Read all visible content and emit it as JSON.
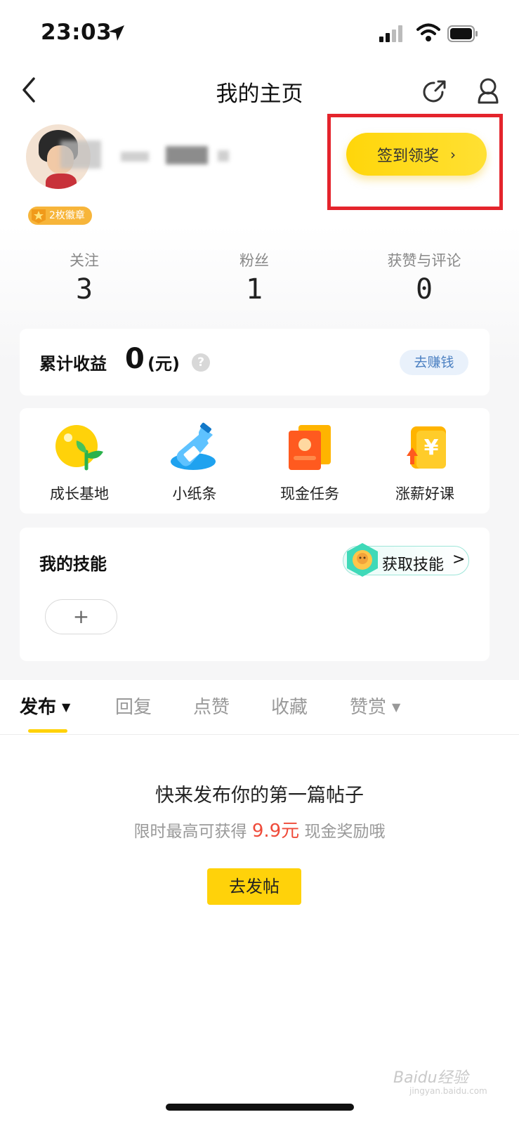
{
  "status_bar": {
    "time": "23:03"
  },
  "nav": {
    "title": "我的主页"
  },
  "profile": {
    "badge_label": "2枚徽章",
    "signin_label": "签到领奖",
    "signin_chevron": "›"
  },
  "stats": [
    {
      "label": "关注",
      "value": "3"
    },
    {
      "label": "粉丝",
      "value": "1"
    },
    {
      "label": "获赞与评论",
      "value": "0"
    }
  ],
  "earnings": {
    "title": "累计收益",
    "value": "0",
    "unit": "(元)",
    "help_symbol": "?",
    "button_label": "去赚钱"
  },
  "shortcuts": [
    {
      "label": "成长基地",
      "icon": "sprout-icon"
    },
    {
      "label": "小纸条",
      "icon": "bottle-icon"
    },
    {
      "label": "现金任务",
      "icon": "cash-card-icon"
    },
    {
      "label": "涨薪好课",
      "icon": "yen-book-icon"
    }
  ],
  "skills": {
    "title": "我的技能",
    "get_label": "获取技能",
    "get_chevron": ">",
    "add_symbol": "+"
  },
  "tabs": [
    {
      "label": "发布",
      "active": true,
      "dropdown": true
    },
    {
      "label": "回复",
      "active": false
    },
    {
      "label": "点赞",
      "active": false
    },
    {
      "label": "收藏",
      "active": false
    },
    {
      "label": "赞赏",
      "active": false,
      "dropdown": true
    }
  ],
  "tab_caret": "▼",
  "empty_state": {
    "title": "快来发布你的第一篇帖子",
    "subtitle_prefix": "限时最高可获得",
    "subtitle_amount": "9.9元",
    "subtitle_suffix": "现金奖励哦",
    "button_label": "去发帖"
  },
  "watermark": {
    "text": "Baidu经验",
    "sub": "jingyan.baidu.com"
  },
  "colors": {
    "accent_yellow": "#ffd20a",
    "highlight_red": "#e4242c",
    "amount_red": "#ef4b3a",
    "link_blue": "#4a7fc1"
  }
}
